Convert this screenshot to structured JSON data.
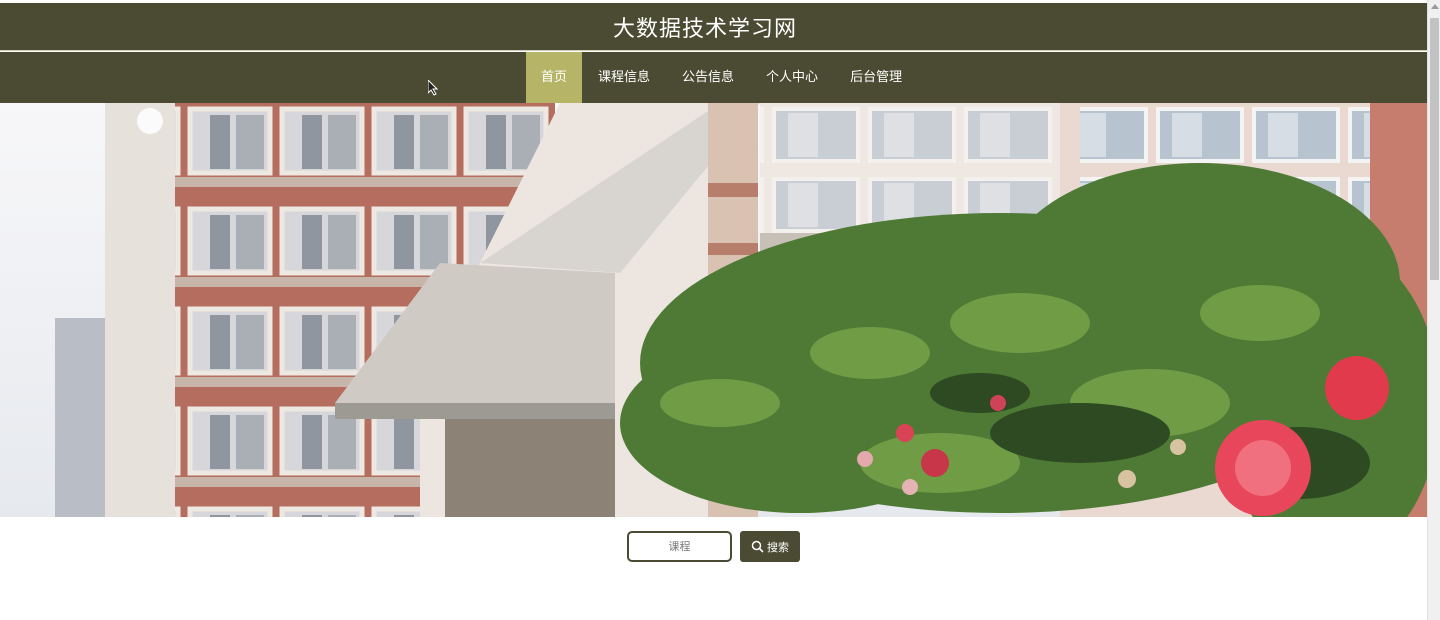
{
  "site": {
    "title": "大数据技术学习网"
  },
  "nav": {
    "items": [
      {
        "label": "首页",
        "active": true
      },
      {
        "label": "课程信息"
      },
      {
        "label": "公告信息"
      },
      {
        "label": "个人中心"
      },
      {
        "label": "后台管理"
      }
    ]
  },
  "search": {
    "placeholder": "课程",
    "button_label": "搜索",
    "button_icon": "search-icon"
  },
  "colors": {
    "header_bg": "#4b4b33",
    "nav_active_bg": "#b5b467",
    "page_bg": "#ffffff"
  }
}
